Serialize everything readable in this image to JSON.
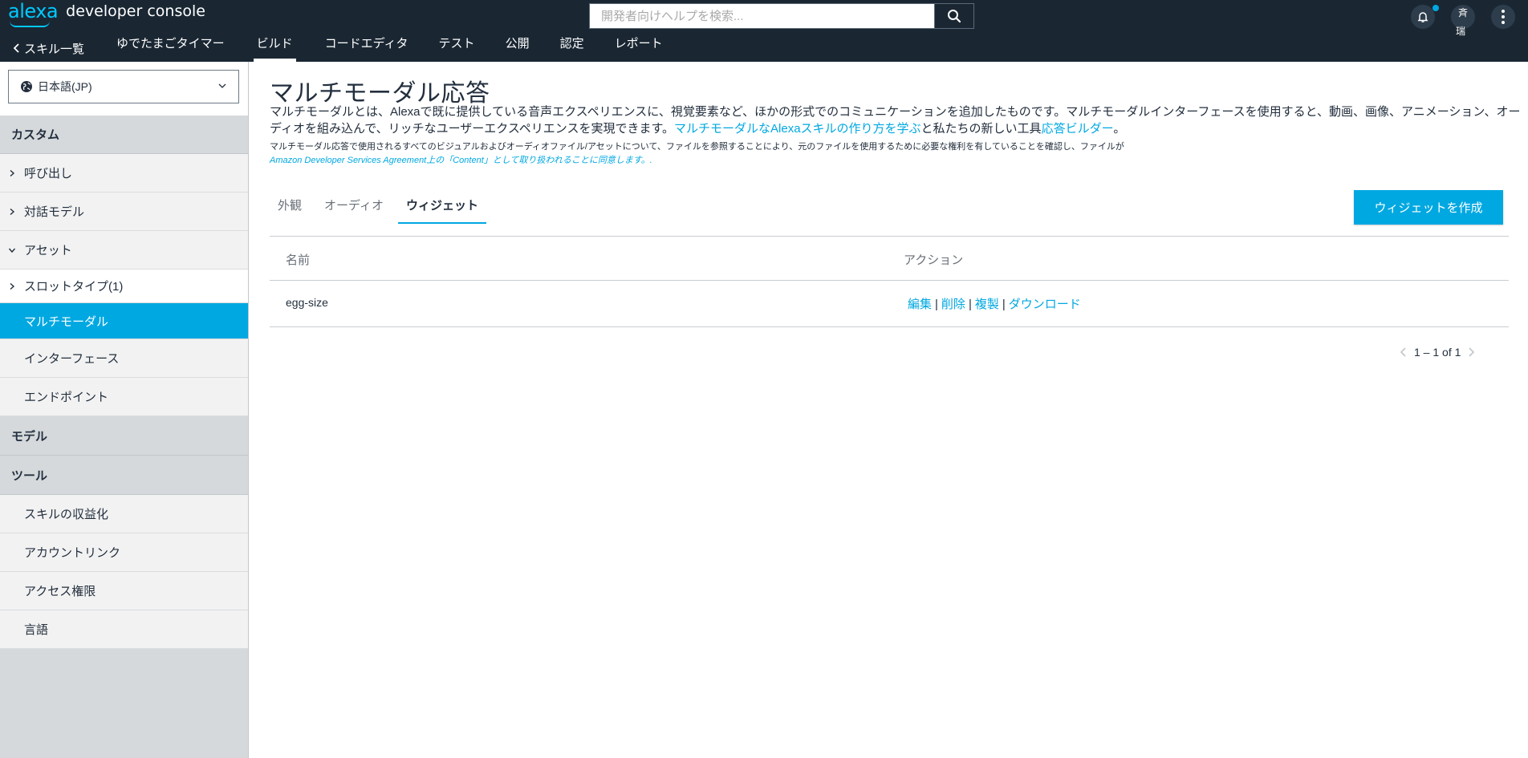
{
  "header": {
    "logo_alexa": "alexa",
    "logo_title": "developer console",
    "search_placeholder": "開発者向けヘルプを検索...",
    "avatar_initial": "斉",
    "avatar_sub": "瑞",
    "notification_dot": true
  },
  "nav": {
    "items": [
      {
        "label": "スキル一覧",
        "back": true
      },
      {
        "label": "ゆでたまごタイマー"
      },
      {
        "label": "ビルド",
        "active": true
      },
      {
        "label": "コードエディタ"
      },
      {
        "label": "テスト"
      },
      {
        "label": "公開"
      },
      {
        "label": "認定"
      },
      {
        "label": "レポート"
      }
    ]
  },
  "sidebar": {
    "language": "日本語(JP)",
    "section_custom": "カスタム",
    "item_invocation": "呼び出し",
    "item_interaction_model": "対話モデル",
    "item_assets": "アセット",
    "item_slot_types": "スロットタイプ(1)",
    "item_multimodal": "マルチモーダル",
    "item_interfaces": "インターフェース",
    "item_endpoint": "エンドポイント",
    "section_model": "モデル",
    "section_tools": "ツール",
    "item_monetization": "スキルの収益化",
    "item_account_linking": "アカウントリンク",
    "item_permissions": "アクセス権限",
    "item_languages": "言語"
  },
  "main": {
    "title": "マルチモーダル応答",
    "desc_part1": "マルチモーダルとは、Alexaで既に提供している音声エクスペリエンスに、視覚要素など、ほかの形式でのコミュニケーションを追加したものです。マルチモーダルインターフェースを使用すると、動画、画像、アニメーション、オーディオを組み込んで、リッチなユーザーエクスペリエンスを実現できます。",
    "desc_link1": "マルチモーダルなAlexaスキルの作り方を学ぶ",
    "desc_part2": "と私たちの新しい工具",
    "desc_link2": "応答ビルダー",
    "desc_part3": "。",
    "note_text": "マルチモーダル応答で使用されるすべてのビジュアルおよびオーディオファイル/アセットについて、ファイルを参照することにより、元のファイルを使用するために必要な権利を有していることを確認し、ファイルが",
    "note_link": "Amazon Developer Services Agreement上の「Content」として取り扱われることに同意します。.",
    "tabs": [
      "外観",
      "オーディオ",
      "ウィジェット"
    ],
    "active_tab": "ウィジェット",
    "create_button": "ウィジェットを作成",
    "table": {
      "col_name": "名前",
      "col_actions": "アクション",
      "rows": [
        {
          "name": "egg-size",
          "actions": [
            "編集",
            "削除",
            "複製",
            "ダウンロード"
          ]
        }
      ]
    },
    "pager": "1 – 1 of 1"
  },
  "colors": {
    "topbar": "#1a2733",
    "accent": "#00a8e1",
    "sidebar_bg": "#d5d9dc"
  }
}
